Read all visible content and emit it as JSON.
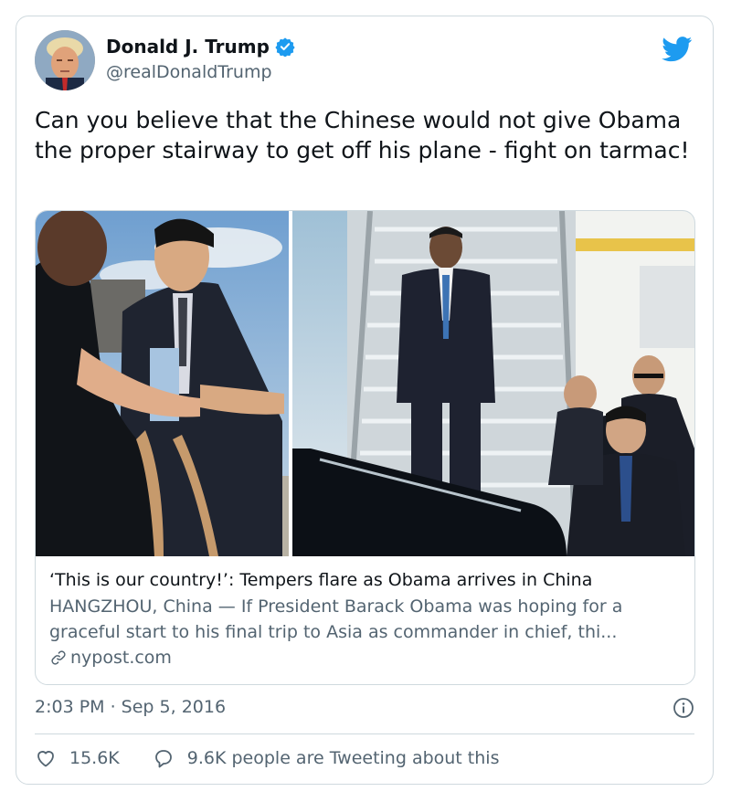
{
  "author": {
    "display_name": "Donald J. Trump",
    "handle": "@realDonaldTrump",
    "verified": true,
    "avatar_icon": "profile-photo"
  },
  "tweet": {
    "text": "Can you believe that the Chinese would not give Obama the proper stairway to get off his plane - fight on tarmac!"
  },
  "link_card": {
    "title": "‘This is our country!’: Tempers flare as Obama arrives in China",
    "description": "HANGZHOU, China — If President Barack Obama was hoping for a graceful start to his final trip to Asia as commander in chief, thi...",
    "domain": "nypost.com",
    "domain_icon": "link-icon"
  },
  "meta": {
    "timestamp": "2:03 PM · Sep 5, 2016",
    "info_icon": "info-icon"
  },
  "actions": {
    "likes": "15.6K",
    "replies_label": "9.6K people are Tweeting about this"
  },
  "colors": {
    "brand_blue": "#1d9bf0",
    "text_primary": "#0f1419",
    "text_secondary": "#536471",
    "border": "#cfd9de"
  }
}
